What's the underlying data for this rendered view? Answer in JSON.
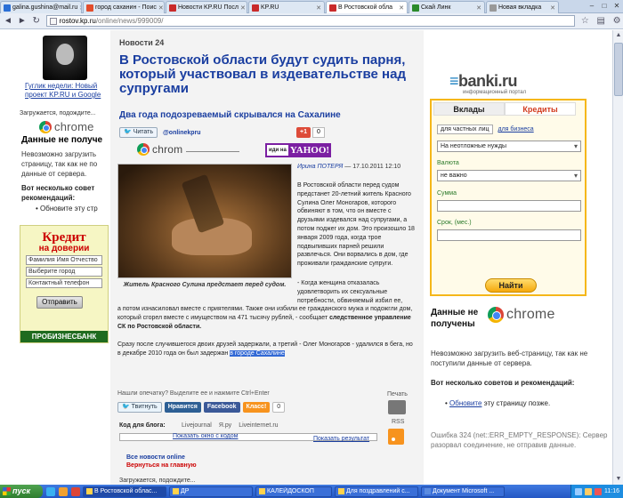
{
  "browser": {
    "tabs": [
      {
        "label": "galina.gushina@mail.ru",
        "color": "#2a6fd6",
        "active": false
      },
      {
        "label": "город саханин - Поис",
        "color": "#e34d2c",
        "active": false
      },
      {
        "label": "Новости KP.RU Посл",
        "color": "#c92a2a",
        "active": false
      },
      {
        "label": "KP.RU",
        "color": "#c92a2a",
        "active": false
      },
      {
        "label": "В Ростовской обла",
        "color": "#c92a2a",
        "active": true
      },
      {
        "label": "Скай Линк",
        "color": "#2a8a2a",
        "active": false
      },
      {
        "label": "Новая вкладка",
        "color": "#999999",
        "active": false
      }
    ],
    "url_host": "rostov.kp.ru",
    "url_path": "/online/news/999009/"
  },
  "left": {
    "promo_text": "Гуглик недели: Новый проект KP.RU и Google",
    "loading": "Загружается, подождите...",
    "chrome_word": "chrome",
    "error_title": "Данные не получе",
    "error_body": "Невозможно загрузить страницу, так как не по данные от сервера.",
    "error_tips": "Вот несколько совет рекомендаций:",
    "error_tip": "Обновите эту стр",
    "credit": {
      "title": "Кредит",
      "subtitle": "на доверии",
      "field1": "Фамилия Имя Отчество",
      "field2": "Выберите город",
      "field3": "Контактный телефон",
      "button": "Отправить",
      "bank": "ПРОБИЗНЕСБАНК"
    }
  },
  "article": {
    "kicker": "Новости 24",
    "headline": "В Ростовской области будут судить парня, который участвовал в издевательстве над супругами",
    "subhead": "Два года подозреваемый скрывался на Сахалине",
    "tw_button": "Читать",
    "tw_user": "@onlinekpru",
    "gplus": "+1",
    "gplus_count": "0",
    "chrome_ad": "chrom",
    "yahoo_go": "иди на",
    "yahoo": "YAHOO!",
    "caption": "Житель Красного Сулина предстает перед судом.",
    "author": "Ирина ПОТЕРЯ",
    "date": " — 17.10.2011 12:10",
    "p1": "В Ростовской области перед судом предстанет 20-летний житель Красного Сулина Олег Моногаров, которого обвиняют в том, что он вместе с друзьями издевался над супругами, а потом поджег их дом. Это произошло 18 января 2009 года, когда трое подвыпивших парней решили развлечься. Они ворвались в дом, где проживали гражданские супруги.",
    "p2": "- Когда женщина отказалась удовлетворить их сексуальные потребности, обвиняемый избил ее,",
    "p3a": "а потом изнасиловал вместе с приятелями. Также они избили ее гражданского мужа и подожгли дом, который сгорел вместе с имуществом на 471 тысячу рублей, - сообщает ",
    "p3b": "следственное управление СК по Ростовской области.",
    "p4a": "Сразу после случившегося двоих друзей задержали, а третий - Олег Моногаров - удалился в бега, но в декабре 2010 года он был задержан ",
    "p4b": "в городе Сахалине"
  },
  "tools": {
    "typo": "Нашли опечатку? Выделите ее и нажмите Ctrl+Enter",
    "tw": "Твитнуть",
    "like": "Нравится",
    "fb": "Facebook",
    "ok": "Класс!",
    "ok_count": "0",
    "print": "Печать",
    "rss": "RSS",
    "code_label": "Код для блога:",
    "blogs": [
      "Livejournal",
      "Я.ру",
      "Liveinternet.ru"
    ],
    "show_code": "Показать окно с кодом",
    "show_result": "Показать результат",
    "all_news": "Все новости online",
    "back_home": "Вернуться на главную",
    "loading": "Загружается, подождите..."
  },
  "banki": {
    "logo_main": "banki.ru",
    "logo_sub": "информационный портал",
    "tab_deposits": "Вклады",
    "tab_credits": "Кредиты",
    "opt_private": "для частных лиц",
    "opt_business": "для бизнеса",
    "purpose": "На неотложные нужды",
    "currency_label": "Валюта",
    "currency": "не важно",
    "sum_label": "Сумма",
    "term_label": "Срок, (мес.)",
    "find": "Найти"
  },
  "right_error": {
    "title": "Данные не получены",
    "chrome_word": "chrome",
    "body": "Невозможно загрузить веб-страницу, так как не поступили данные от сервера.",
    "tips": "Вот несколько советов и рекомендаций:",
    "tip_link": "Обновите",
    "tip_rest": " эту страницу позже.",
    "code": "Ошибка 324 (net::ERR_EMPTY_RESPONSE): Сервер разорвал соединение, не отправив данные."
  },
  "taskbar": {
    "start": "пуск",
    "items": [
      "В Ростовской облас...",
      "ДР",
      "КАЛЕЙДОСКОП",
      "Для поздравлений с...",
      "Документ Microsoft ..."
    ],
    "clock": "11:16"
  }
}
